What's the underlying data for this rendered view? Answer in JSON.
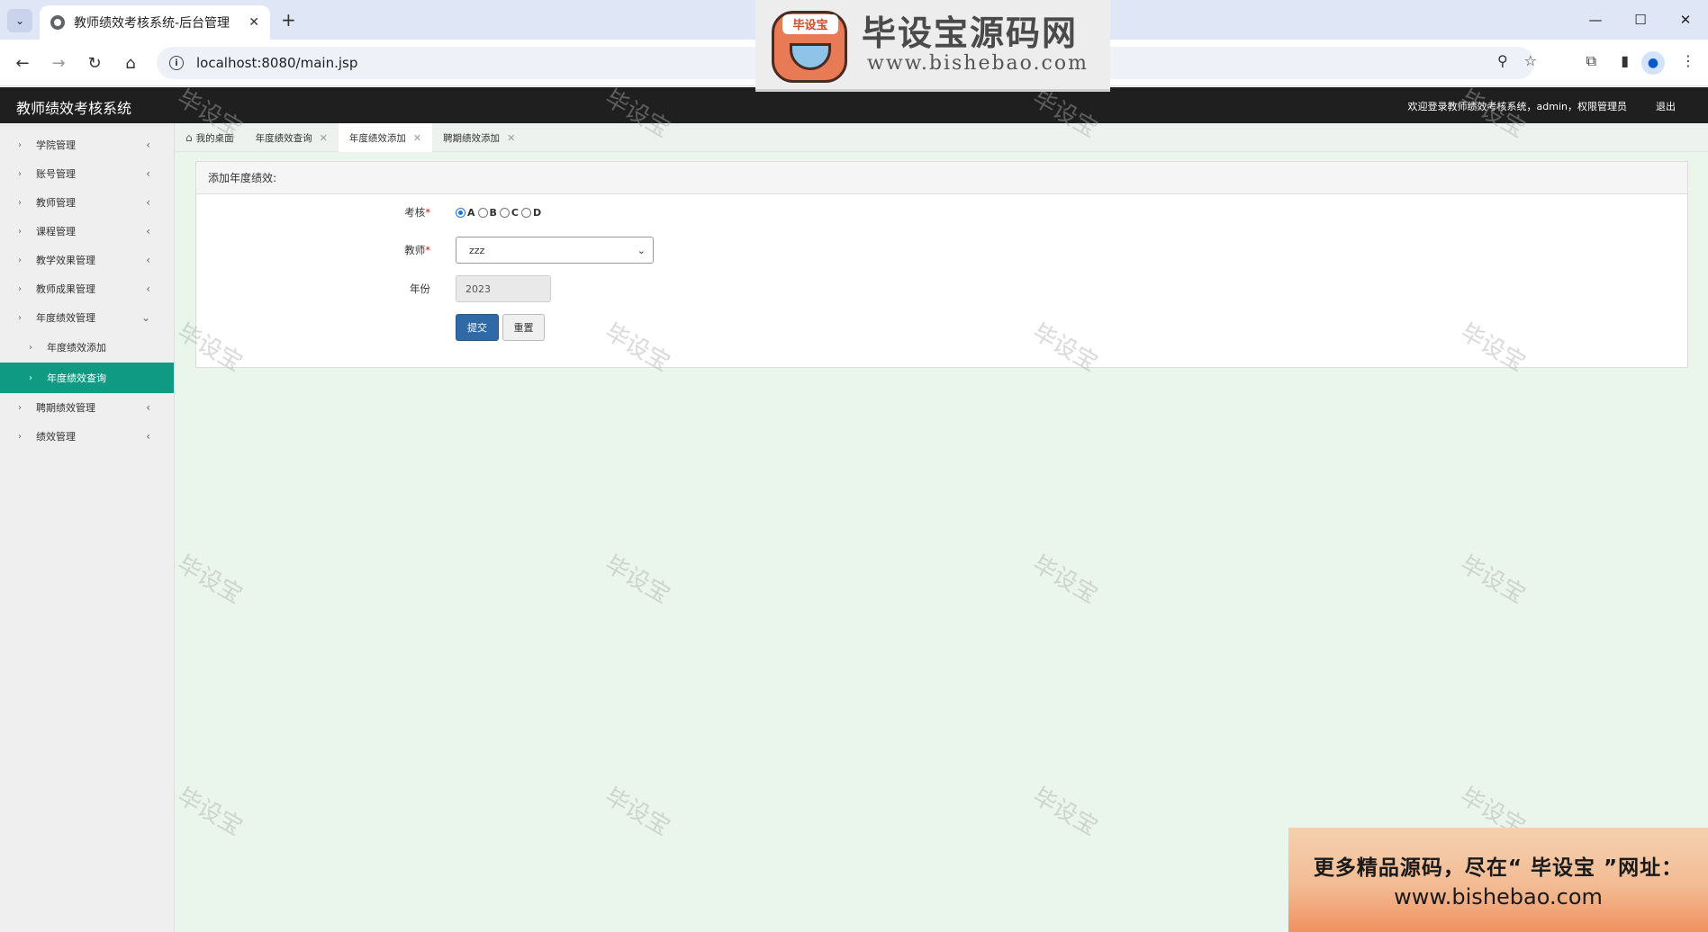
{
  "browser": {
    "tab_title": "教师绩效考核系统-后台管理",
    "url": "localhost:8080/main.jsp"
  },
  "app": {
    "title": "教师绩效考核系统",
    "welcome": "欢迎登录教师绩效考核系统，admin，权限管理员",
    "logout": "退出"
  },
  "sidebar": {
    "items": [
      {
        "label": "学院管理"
      },
      {
        "label": "账号管理"
      },
      {
        "label": "教师管理"
      },
      {
        "label": "课程管理"
      },
      {
        "label": "教学效果管理"
      },
      {
        "label": "教师成果管理"
      },
      {
        "label": "年度绩效管理"
      },
      {
        "label": "年度绩效添加"
      },
      {
        "label": "年度绩效查询"
      },
      {
        "label": "聘期绩效管理"
      },
      {
        "label": "绩效管理"
      }
    ]
  },
  "page_tabs": [
    {
      "label": "我的桌面"
    },
    {
      "label": "年度绩效查询"
    },
    {
      "label": "年度绩效添加"
    },
    {
      "label": "聘期绩效添加"
    }
  ],
  "form": {
    "heading": "添加年度绩效:",
    "grade_label": "考核",
    "required_mark": "*",
    "grade_options": [
      "A",
      "B",
      "C",
      "D"
    ],
    "teacher_label": "教师",
    "teacher_value": "zzz",
    "year_label": "年份",
    "year_value": "2023",
    "submit": "提交",
    "reset": "重置"
  },
  "watermark": "毕设宝",
  "brand": {
    "badge": "毕设宝",
    "name": "毕设宝源码网",
    "url": "www.bishebao.com"
  },
  "promo": {
    "line1": "更多精品源码，尽在“ 毕设宝 ”网址：",
    "line2": "www.bishebao.com"
  }
}
